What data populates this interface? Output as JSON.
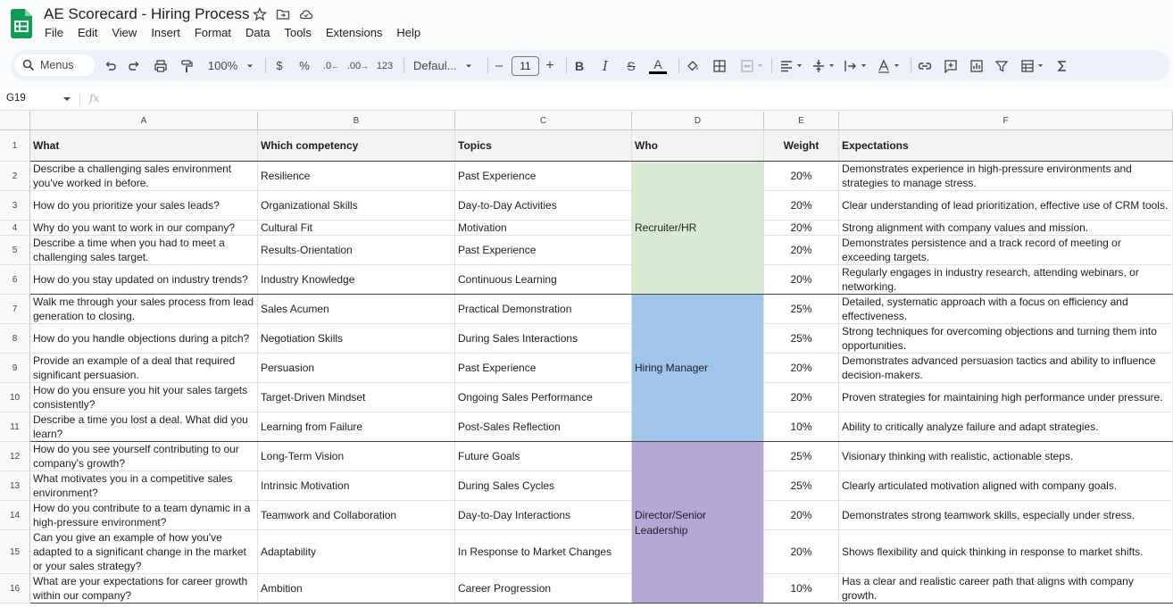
{
  "app": {
    "title": "AE Scorecard - Hiring Process",
    "menu": [
      "File",
      "Edit",
      "View",
      "Insert",
      "Format",
      "Data",
      "Tools",
      "Extensions",
      "Help"
    ]
  },
  "toolbar": {
    "search_label": "Menus",
    "zoom": "100%",
    "currency": "$",
    "percent": "%",
    "dec_decrease": ".0",
    "dec_increase": ".00",
    "number_format": "123",
    "font": "Defaul...",
    "font_size": "11",
    "minus": "–",
    "plus": "+",
    "bold": "B",
    "italic": "I",
    "strike": "S",
    "text_color_label": "A",
    "text_color": "#000000"
  },
  "formula_bar": {
    "cell_ref": "G19",
    "fx": "fx"
  },
  "sheet": {
    "columns": [
      "A",
      "B",
      "C",
      "D",
      "E",
      "F"
    ],
    "headers": [
      "What",
      "Which competency",
      "Topics",
      "Who",
      "Weight",
      "Expectations"
    ],
    "rows": [
      [
        "Describe a challenging sales environment you've worked in before.",
        "Resilience",
        "Past Experience",
        "20%",
        "Demonstrates experience in high-pressure environments and strategies to manage stress."
      ],
      [
        "How do you prioritize your sales leads?",
        "Organizational Skills",
        "Day-to-Day Activities",
        "20%",
        "Clear understanding of lead prioritization, effective use of CRM tools."
      ],
      [
        "Why do you want to work in our company?",
        "Cultural Fit",
        "Motivation",
        "20%",
        "Strong alignment with company values and mission."
      ],
      [
        "Describe a time when you had to meet a challenging sales target.",
        "Results-Orientation",
        "Past Experience",
        "20%",
        "Demonstrates persistence and a track record of meeting or exceeding targets."
      ],
      [
        "How do you stay updated on industry trends?",
        "Industry Knowledge",
        "Continuous Learning",
        "20%",
        "Regularly engages in industry research, attending webinars, or networking."
      ],
      [
        "Walk me through your sales process from lead generation to closing.",
        "Sales Acumen",
        "Practical Demonstration",
        "25%",
        "Detailed, systematic approach with a focus on efficiency and effectiveness."
      ],
      [
        "How do you handle objections during a pitch?",
        "Negotiation Skills",
        "During Sales Interactions",
        "25%",
        "Strong techniques for overcoming objections and turning them into opportunities."
      ],
      [
        "Provide an example of a deal that required significant persuasion.",
        "Persuasion",
        "Past Experience",
        "20%",
        "Demonstrates advanced persuasion tactics and ability to influence decision-makers."
      ],
      [
        "How do you ensure you hit your sales targets consistently?",
        "Target-Driven Mindset",
        "Ongoing Sales Performance",
        "20%",
        "Proven strategies for maintaining high performance under pressure."
      ],
      [
        "Describe a time you lost a deal. What did you learn?",
        "Learning from Failure",
        "Post-Sales Reflection",
        "10%",
        "Ability to critically analyze failure and adapt strategies."
      ],
      [
        "How do you see yourself contributing to our company's growth?",
        "Long-Term Vision",
        "Future Goals",
        "25%",
        "Visionary thinking with realistic, actionable steps."
      ],
      [
        "What motivates you in a competitive sales environment?",
        "Intrinsic Motivation",
        "During Sales Cycles",
        "25%",
        "Clearly articulated motivation aligned with company goals."
      ],
      [
        "How do you contribute to a team dynamic in a high-pressure environment?",
        "Teamwork and Collaboration",
        "Day-to-Day Interactions",
        "20%",
        "Demonstrates strong teamwork skills, especially under stress."
      ],
      [
        "Can you give an example of how you've adapted to a significant change in the market or your sales strategy?",
        "Adaptability",
        "In Response to Market Changes",
        "20%",
        "Shows flexibility and quick thinking in response to market shifts."
      ],
      [
        "What are your expectations for career growth within our company?",
        "Ambition",
        "Career Progression",
        "10%",
        "Has a clear and realistic career path that aligns with company growth."
      ]
    ],
    "who_groups": [
      {
        "label": "Recruiter/HR",
        "color": "#d9ead3"
      },
      {
        "label": "Hiring Manager",
        "color": "#9fc5e8"
      },
      {
        "label": "Director/Senior Leadership",
        "color": "#b4a7d6"
      }
    ]
  }
}
